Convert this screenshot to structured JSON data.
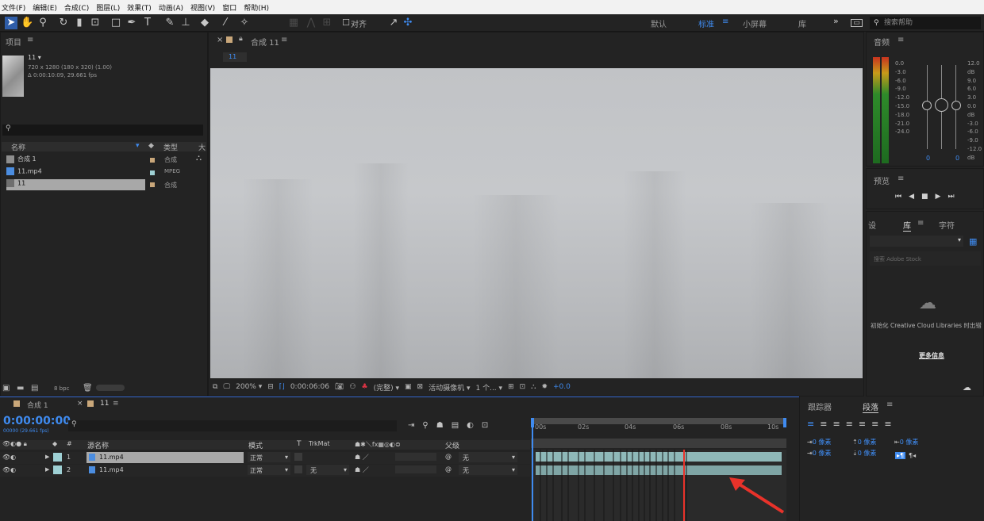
{
  "menu": [
    "文件(F)",
    "编辑(E)",
    "合成(C)",
    "图层(L)",
    "效果(T)",
    "动画(A)",
    "视图(V)",
    "窗口",
    "帮助(H)"
  ],
  "toolbar": {
    "align_label": "对齐",
    "workspaces": [
      "默认",
      "标准",
      "小屏幕",
      "库"
    ],
    "active_workspace": "标准",
    "more": "»",
    "help_placeholder": "搜索帮助"
  },
  "project": {
    "title": "项目",
    "item_name": "11",
    "item_info_1": "720 x 1280 (180 x 320) (1.00)",
    "item_info_2": "Δ 0:00:10:09, 29.661 fps",
    "col_name": "名称",
    "col_type": "类型",
    "col_more": "大",
    "rows": [
      {
        "name": "合成 1",
        "type": "合成",
        "swatch": "#c9a77a"
      },
      {
        "name": "11.mp4",
        "type": "MPEG",
        "swatch": "#9ed0d4"
      },
      {
        "name": "11",
        "type": "合成",
        "swatch": "#c9a77a"
      }
    ],
    "bpc": "8 bpc"
  },
  "composition": {
    "tab_label": "合成 11",
    "breadcrumb": "11",
    "zoom": "200%",
    "timecode": "0:00:06:06",
    "resolution": "(完整)",
    "camera": "活动摄像机",
    "views": "1 个...",
    "exposure": "+0.0"
  },
  "audio": {
    "title": "音频",
    "left_scale": [
      "0.0",
      "-3.0",
      "-6.0",
      "-9.0",
      "-12.0",
      "-15.0",
      "-18.0",
      "-21.0",
      "-24.0"
    ],
    "right_scale": [
      "12.0 dB",
      "9.0",
      "6.0",
      "3.0",
      "0.0 dB",
      "-3.0",
      "-6.0",
      "-9.0",
      "-12.0 dB"
    ],
    "left_value": "0",
    "right_value": "0"
  },
  "preview": {
    "title": "预览"
  },
  "library": {
    "tab_left": "设",
    "tab_library": "库",
    "tab_chars": "字符",
    "search_placeholder": "搜索 Adobe Stock",
    "message": "初始化 Creative Cloud Libraries 时出错",
    "more_info": "更多信息"
  },
  "timeline": {
    "tab_comp1": "合成 1",
    "tab_11": "11",
    "timecode": "0:00:00:00",
    "timecode_sub": "00000 (29.661 fps)",
    "col_source": "源名称",
    "col_mode": "模式",
    "col_t": "T",
    "col_trkmat": "TrkMat",
    "col_parent": "父级",
    "ruler": [
      "00s",
      "02s",
      "04s",
      "06s",
      "08s",
      "10s"
    ],
    "layers": [
      {
        "num": "1",
        "name": "11.mp4",
        "mode": "正常",
        "trkmat": "",
        "parent": "无"
      },
      {
        "num": "2",
        "name": "11.mp4",
        "mode": "正常",
        "trkmat": "无",
        "parent": "无"
      }
    ],
    "bar_color": "#8fb9b9",
    "playhead_color": "#e8322a",
    "arrow_color": "#e8322a"
  },
  "paragraph": {
    "tab_tracker": "跟踪器",
    "tab_paragraph": "段落",
    "indent_values": [
      "0 像素",
      "0 像素",
      "0 像素",
      "0 像素",
      "0 像素"
    ]
  }
}
